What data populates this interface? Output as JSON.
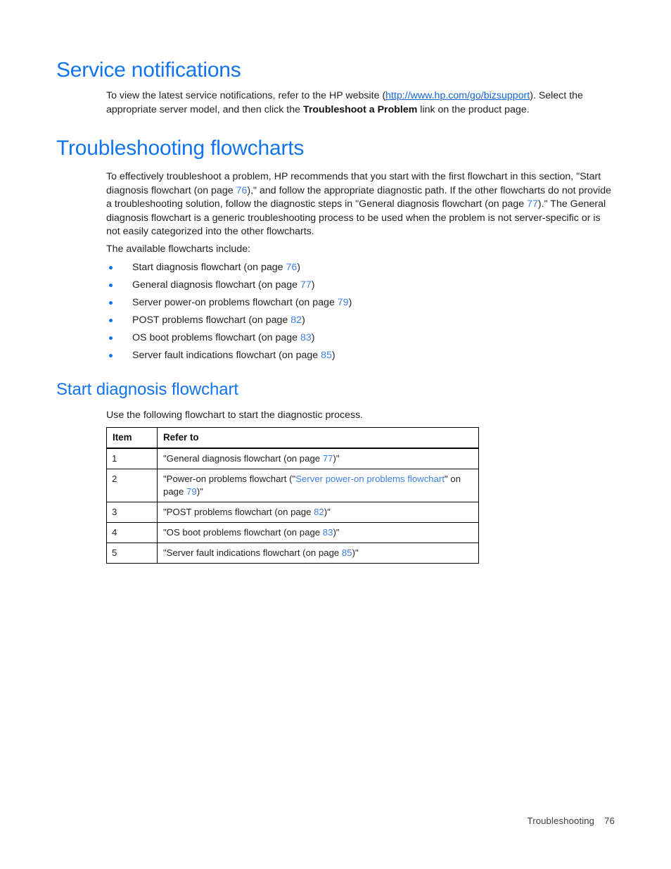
{
  "document": {
    "sections": [
      {
        "id": "service-notifications",
        "heading": "Service notifications",
        "paragraph_prefix": "To view the latest service notifications, refer to the HP website (",
        "link_text": "http://www.hp.com/go/bizsupport",
        "paragraph_mid": "). Select the appropriate server model, and then click the ",
        "bold_text": "Troubleshoot a Problem",
        "paragraph_suffix": " link on the product page."
      },
      {
        "id": "troubleshooting-flowcharts",
        "heading": "Troubleshooting flowcharts",
        "intro_p1": "To effectively troubleshoot a problem, HP recommends that you start with the first flowchart in this section, \"Start diagnosis flowchart (on page ",
        "intro_p1_page_a": "76",
        "intro_p2": "),\" and follow the appropriate diagnostic path. If the other flowcharts do not provide a troubleshooting solution, follow the diagnostic steps in \"General diagnosis flowchart (on page ",
        "intro_p1_page_b": "77",
        "intro_p3": ").\" The General diagnosis flowchart is a generic troubleshooting process to be used when the problem is not server-specific or is not easily categorized into the other flowcharts.",
        "list_lead_in": "The available flowcharts include:",
        "bullets": [
          {
            "text_before": "Start diagnosis flowchart (on page ",
            "page": "76",
            "text_after": ")"
          },
          {
            "text_before": "General diagnosis flowchart (on page ",
            "page": "77",
            "text_after": ")"
          },
          {
            "text_before": "Server power-on problems flowchart (on page ",
            "page": "79",
            "text_after": ")"
          },
          {
            "text_before": "POST problems flowchart (on page ",
            "page": "82",
            "text_after": ")"
          },
          {
            "text_before": "OS boot problems flowchart (on page ",
            "page": "83",
            "text_after": ")"
          },
          {
            "text_before": "Server fault indications flowchart (on page ",
            "page": "85",
            "text_after": ")"
          }
        ]
      },
      {
        "id": "start-diagnosis-flowchart",
        "heading": "Start diagnosis flowchart",
        "intro": "Use the following flowchart to start the diagnostic process."
      }
    ]
  },
  "table": {
    "headers": {
      "item": "Item",
      "refer_to": "Refer to"
    },
    "rows": [
      {
        "item": "1",
        "pre": "\"General diagnosis flowchart (on page ",
        "link": "",
        "mid": "",
        "page": "77",
        "post": ")\""
      },
      {
        "item": "2",
        "pre": "\"Power-on problems flowchart (\"",
        "link": "Server power-on problems flowchart",
        "mid": "\" on page ",
        "page": "79",
        "post": ")\""
      },
      {
        "item": "3",
        "pre": "\"POST problems flowchart (on page ",
        "link": "",
        "mid": "",
        "page": "82",
        "post": ")\""
      },
      {
        "item": "4",
        "pre": "\"OS boot problems flowchart (on page ",
        "link": "",
        "mid": "",
        "page": "83",
        "post": ")\""
      },
      {
        "item": "5",
        "pre": "\"Server fault indications flowchart (on page ",
        "link": "",
        "mid": "",
        "page": "85",
        "post": ")\""
      }
    ]
  },
  "footer": {
    "chapter": "Troubleshooting",
    "page_number": "76"
  },
  "colors": {
    "heading_blue": "#1274EE",
    "link_blue": "#1565D8",
    "page_ref_blue": "#3D7FE8",
    "body_text": "#231f20",
    "table_border": "#000000"
  }
}
